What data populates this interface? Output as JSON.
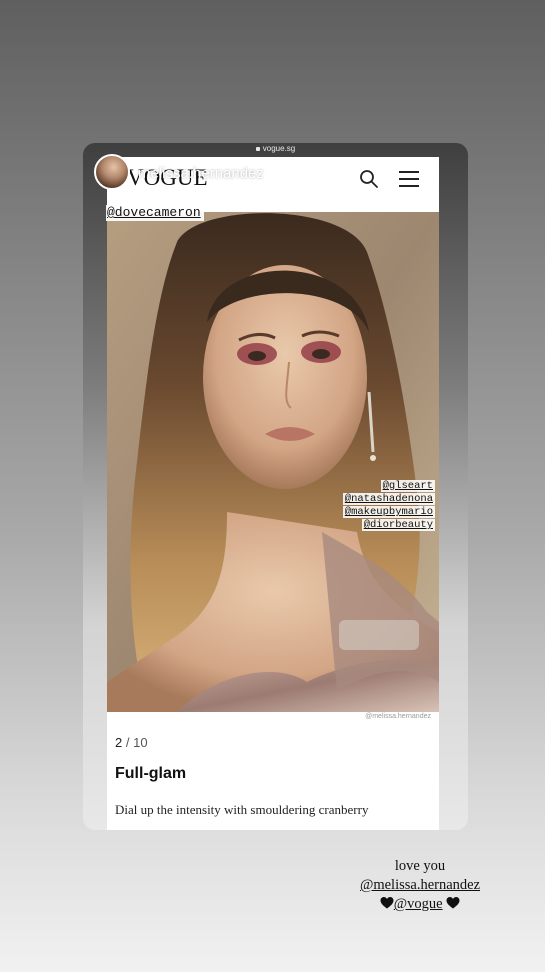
{
  "story": {
    "username": "melissa.hernandez",
    "image_tags": {
      "main": "@dovecameron",
      "credits": [
        "@glseart",
        "@natashadenona",
        "@makeupbymario",
        "@diorbeauty"
      ]
    },
    "caption": {
      "line1": "love you",
      "mention1": "@melissa.hernandez",
      "mention2": "@vogue",
      "heart_color": "#111111"
    }
  },
  "browser": {
    "url": "vogue.sg"
  },
  "site": {
    "logo": "VOGUE",
    "icons": [
      "search-icon",
      "hamburger-menu-icon"
    ],
    "gallery": {
      "photo_credit": "@melissa.hernandez",
      "current": "2",
      "separator": "/",
      "total": "10",
      "slide_title": "Full-glam",
      "slide_description": "Dial up the intensity with smouldering cranberry"
    }
  }
}
